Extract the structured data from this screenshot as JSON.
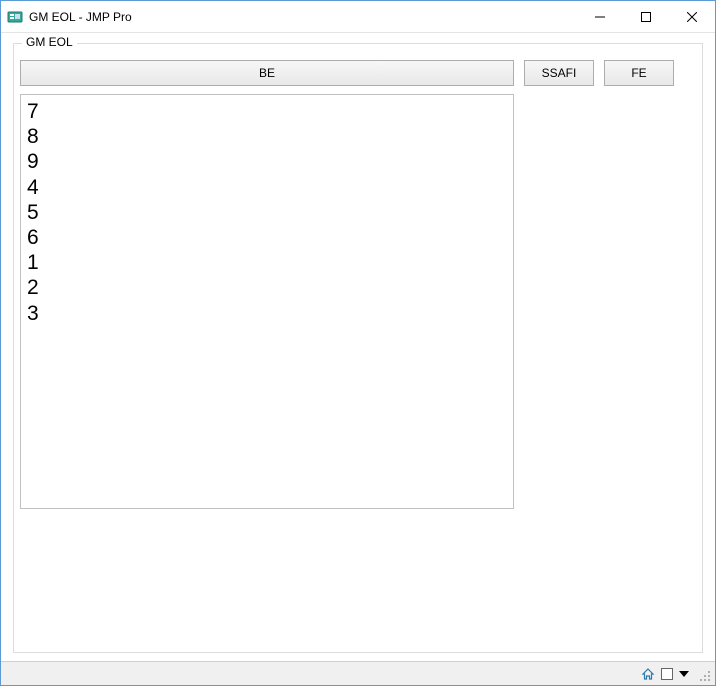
{
  "window": {
    "title": "GM EOL - JMP Pro"
  },
  "group": {
    "legend": "GM EOL"
  },
  "buttons": {
    "be": "BE",
    "ssafi": "SSAFI",
    "fe": "FE"
  },
  "list": {
    "items": [
      "7",
      "8",
      "9",
      "4",
      "5",
      "6",
      "1",
      "2",
      "3"
    ]
  }
}
